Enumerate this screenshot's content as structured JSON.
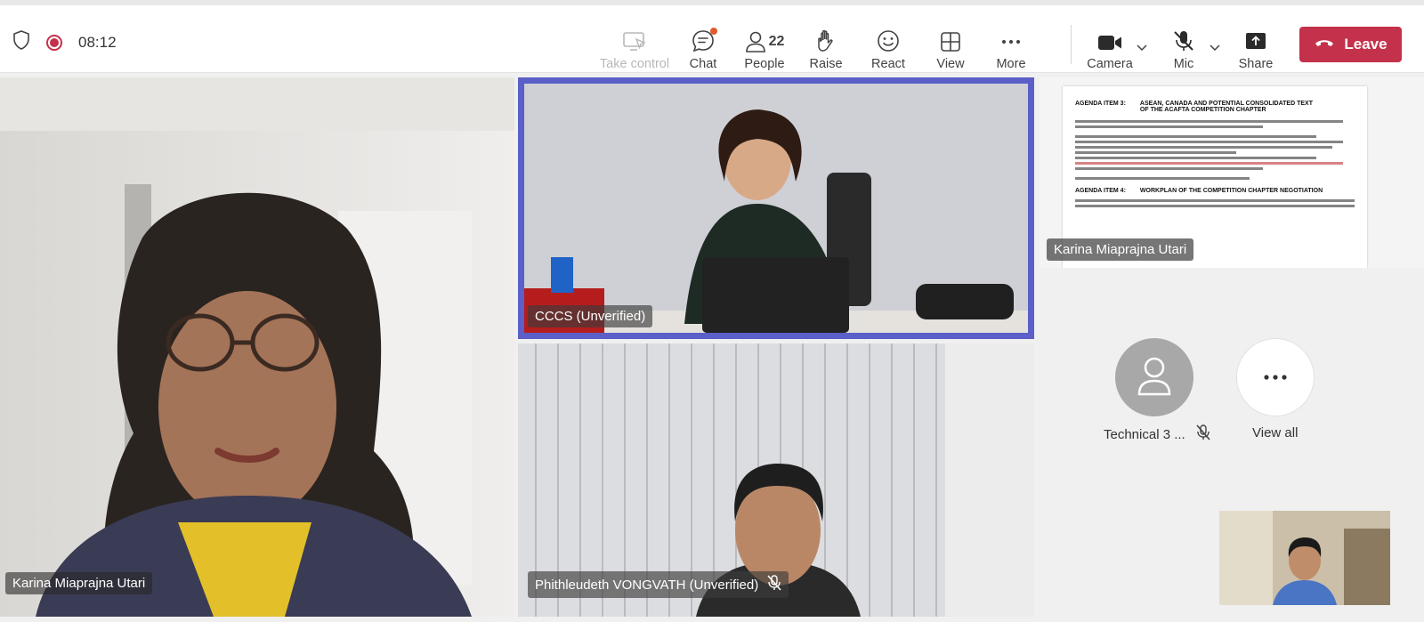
{
  "status": {
    "timer": "08:12"
  },
  "toolbar": {
    "take_control": "Take control",
    "chat": "Chat",
    "people": "People",
    "people_count": "22",
    "raise": "Raise",
    "react": "React",
    "view": "View",
    "more": "More",
    "camera": "Camera",
    "mic": "Mic",
    "share": "Share",
    "leave": "Leave"
  },
  "colors": {
    "leave": "#c4314b",
    "active_speaker_border": "#5b5fc7",
    "chat_badge": "#e05a2b"
  },
  "participants": {
    "main_left": "Karina Miaprajna Utari",
    "active": "CCCS (Unverified)",
    "bottom": "Phithleudeth VONGVATH (Unverified)",
    "screen_share": "Karina Miaprajna Utari"
  },
  "document": {
    "agenda3_label": "AGENDA ITEM 3:",
    "agenda3_title_1": "ASEAN, CANADA AND POTENTIAL CONSOLIDATED TEXT",
    "agenda3_title_2": "OF THE ACAFTA COMPETITION CHAPTER",
    "agenda4_label": "AGENDA ITEM 4:",
    "agenda4_title": "WORKPLAN OF THE COMPETITION CHAPTER NEGOTIATION"
  },
  "gallery": {
    "technical_name": "Technical 3 ...",
    "view_all": "View all"
  }
}
